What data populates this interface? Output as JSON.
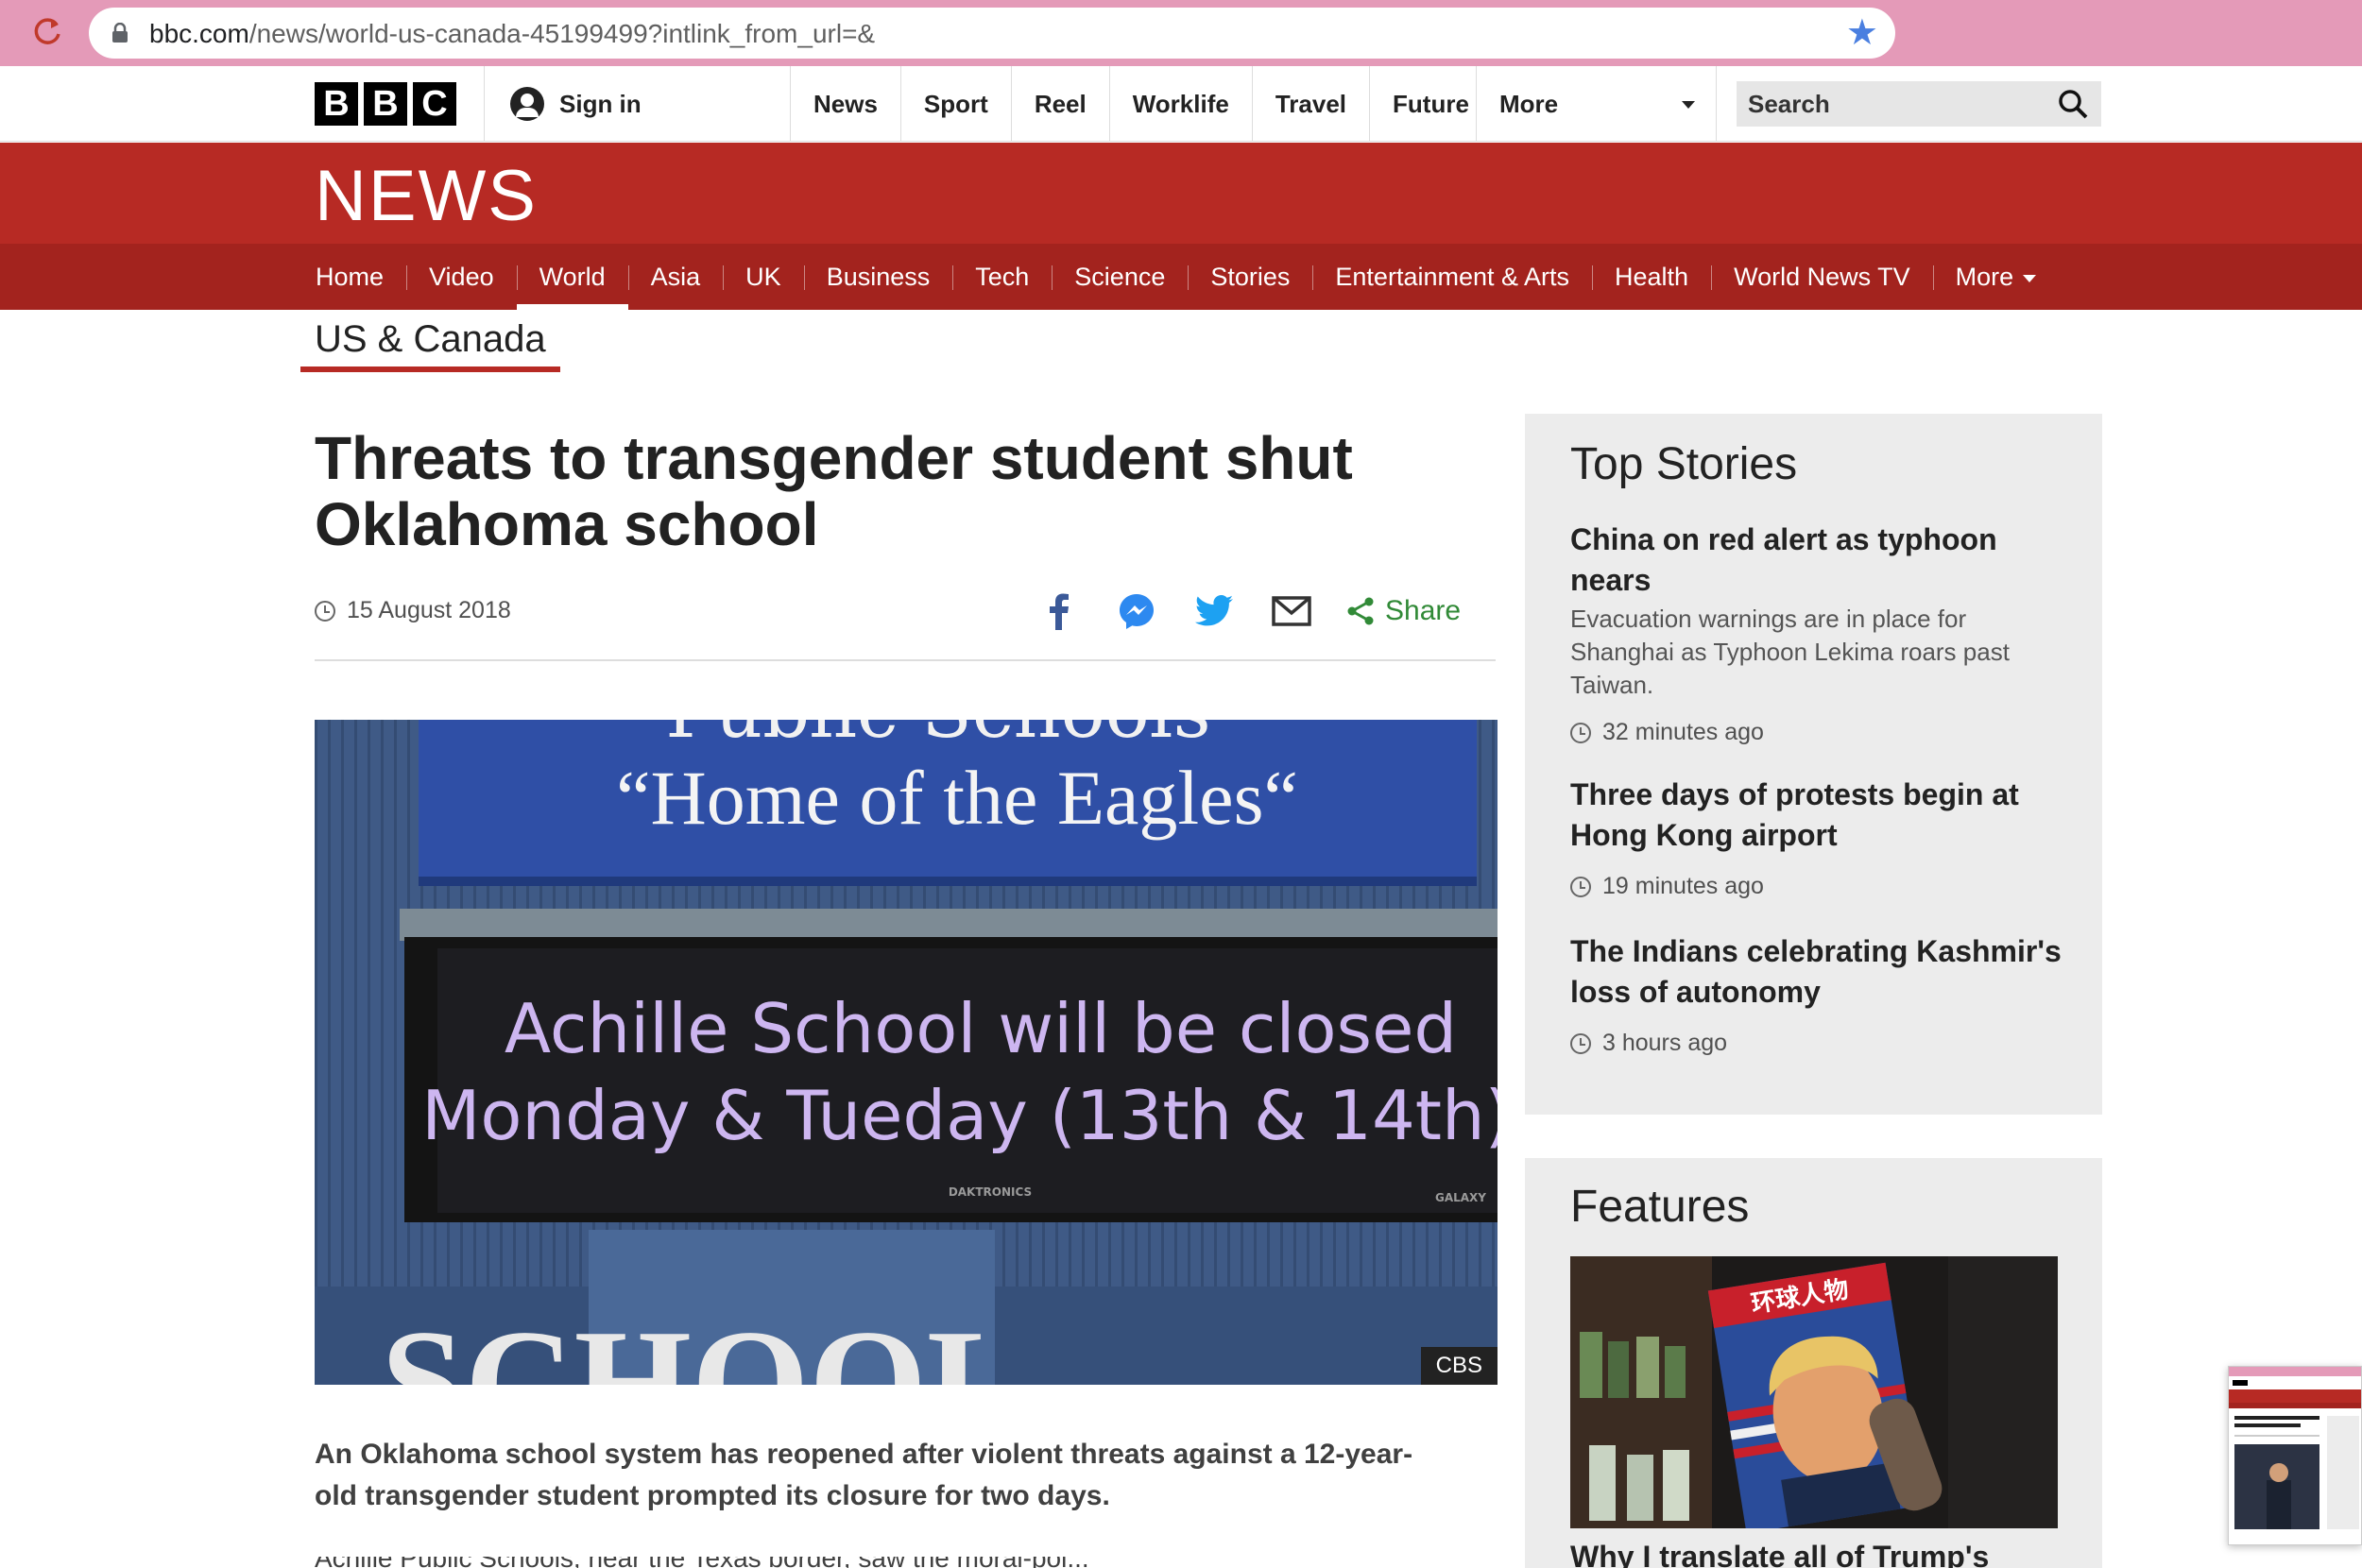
{
  "browser": {
    "url_host": "bbc.com",
    "url_path": "/news/world-us-canada-45199499?intlink_from_url=&"
  },
  "topnav": {
    "logo_letters": [
      "B",
      "B",
      "C"
    ],
    "signin_label": "Sign in",
    "items": [
      "News",
      "Sport",
      "Reel",
      "Worklife",
      "Travel",
      "Future"
    ],
    "more_label": "More",
    "search_placeholder": "Search"
  },
  "banner": {
    "title": "NEWS"
  },
  "subnav": {
    "items": [
      "Home",
      "Video",
      "World",
      "Asia",
      "UK",
      "Business",
      "Tech",
      "Science",
      "Stories",
      "Entertainment & Arts",
      "Health",
      "World News TV",
      "More"
    ],
    "active_index": 2
  },
  "section": {
    "title": "US & Canada"
  },
  "article": {
    "headline": "Threats to transgender student shut Oklahoma school",
    "date": "15 August 2018",
    "share_label": "Share",
    "image": {
      "sign_top_text": "Public Schools",
      "sign_slogan": "“Home of the Eagles“",
      "board_line1": "Achille School will be closed",
      "board_line2": "Monday & Tueday (13th & 14th)",
      "brand_left": "DAKTRONICS",
      "brand_right": "GALAXY",
      "bottom_text": "SCHOOL",
      "credit": "CBS"
    },
    "lead": "An Oklahoma school system has reopened after violent threats against a 12-year-old transgender student prompted its closure for two days.",
    "next_paragraph": "Achille Public Schools, near the Texas border, saw the moral-pol..."
  },
  "sidebar": {
    "top_stories_title": "Top Stories",
    "stories": [
      {
        "title": "China on red alert as typhoon nears",
        "summary": "Evacuation warnings are in place for Shanghai as Typhoon Lekima roars past Taiwan.",
        "time": "32 minutes ago"
      },
      {
        "title": "Three days of protests begin at Hong Kong airport",
        "summary": "",
        "time": "19 minutes ago"
      },
      {
        "title": "The Indians celebrating Kashmir's loss of autonomy",
        "summary": "",
        "time": "3 hours ago"
      }
    ],
    "features_title": "Features",
    "feature_caption": "Why I translate all of Trump's",
    "feature_magazine_title": "环球人物"
  },
  "colors": {
    "bbc_red": "#b72a24",
    "subnav_red": "#a3231e",
    "share_green": "#318a37",
    "chrome_pink": "#e49ab8"
  },
  "icons": {
    "reload": "reload-icon",
    "lock": "lock-icon",
    "bookmark": "star-icon",
    "search": "search-icon",
    "clock": "clock-icon",
    "facebook": "facebook-icon",
    "messenger": "messenger-icon",
    "twitter": "twitter-icon",
    "email": "email-icon",
    "share": "share-icon"
  }
}
